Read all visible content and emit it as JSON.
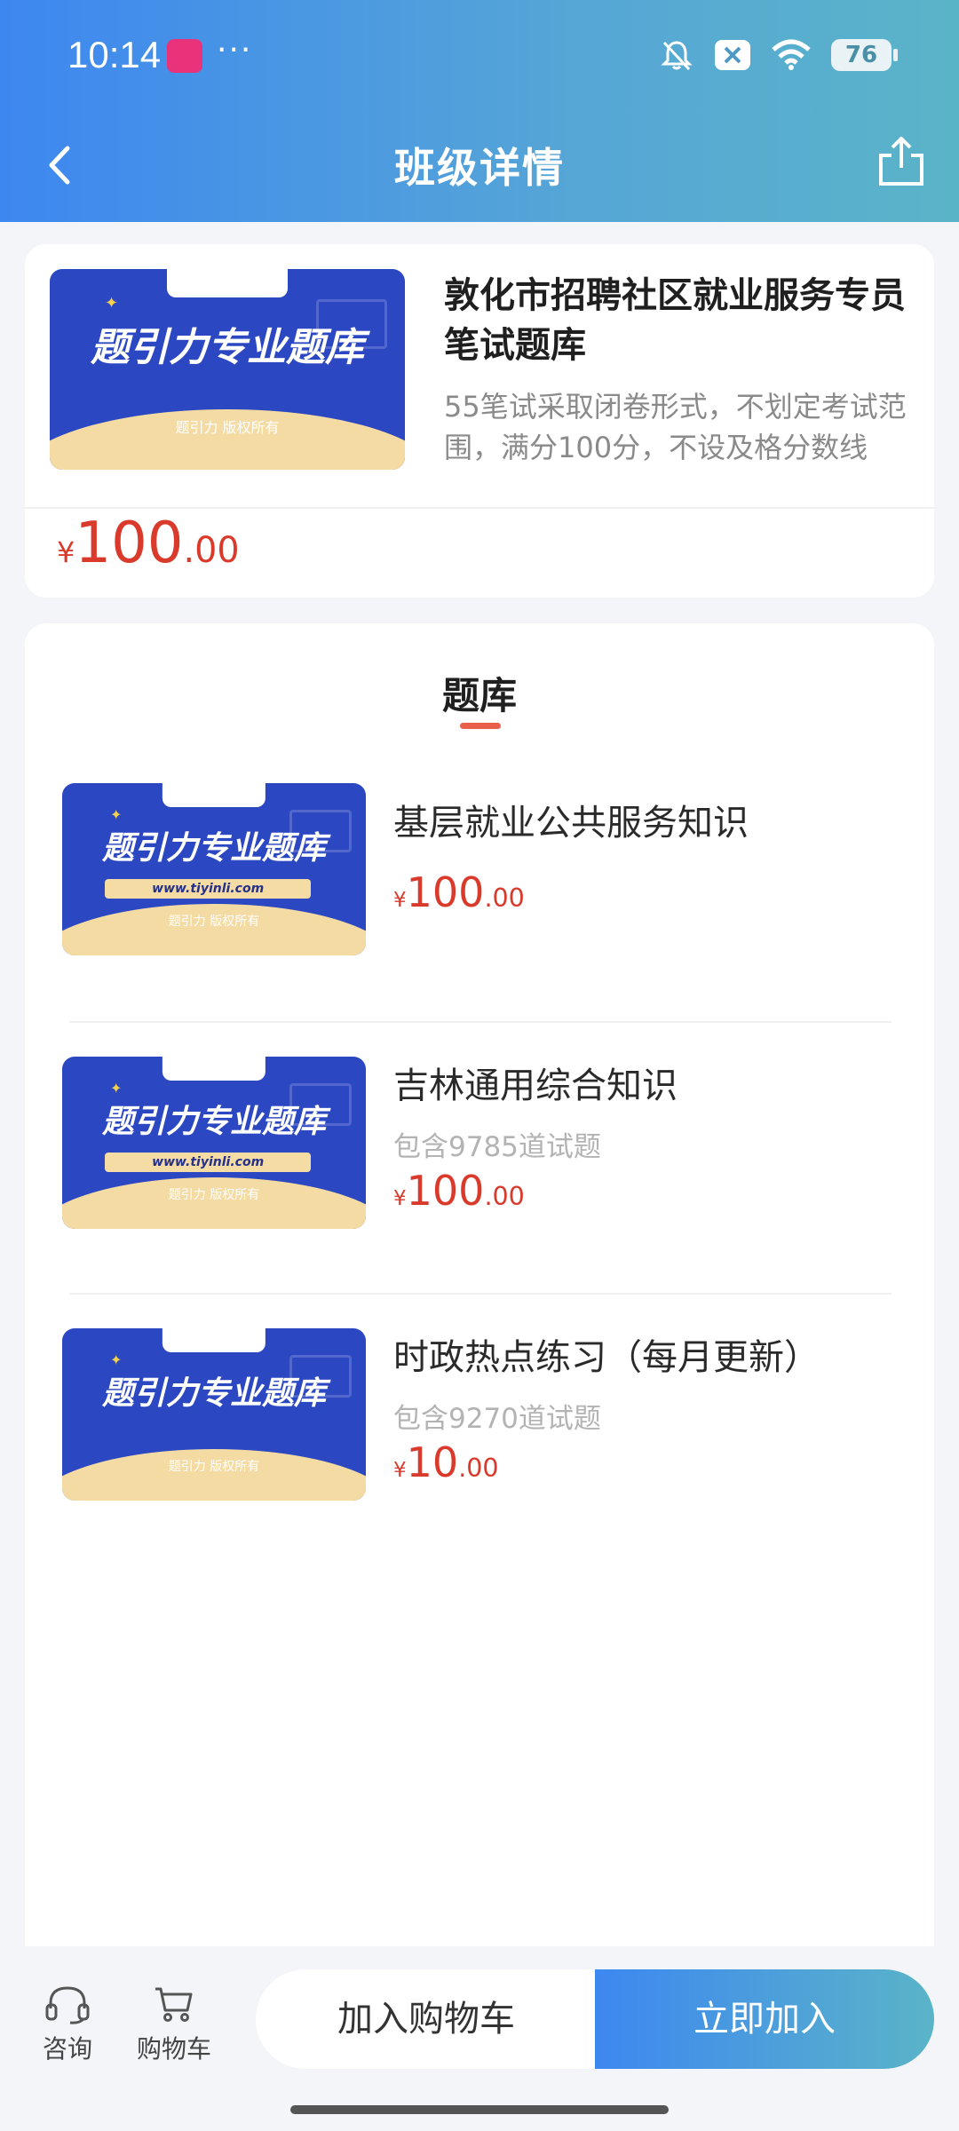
{
  "status_bar": {
    "time": "10:14",
    "dots": "···",
    "battery": "76"
  },
  "nav": {
    "title": "班级详情"
  },
  "class_card": {
    "banner": {
      "title": "题引力专业题库",
      "copyright": "题引力 版权所有"
    },
    "title": "敦化市招聘社区就业服务专员笔试题库",
    "description": "55笔试采取闭卷形式，不划定考试范围，满分100分，不设及格分数线",
    "price": {
      "currency": "¥",
      "integer": "100",
      "decimal": ".00"
    }
  },
  "question_bank": {
    "section_title": "题库",
    "items": [
      {
        "name": "基层就业公共服务知识",
        "count": "",
        "price": {
          "currency": "¥",
          "integer": "100",
          "decimal": ".00"
        },
        "banner": {
          "title": "题引力专业题库",
          "url": "www.tiyinli.com",
          "copyright": "题引力 版权所有"
        }
      },
      {
        "name": "吉林通用综合知识",
        "count": "包含9785道试题",
        "price": {
          "currency": "¥",
          "integer": "100",
          "decimal": ".00"
        },
        "banner": {
          "title": "题引力专业题库",
          "url": "www.tiyinli.com",
          "copyright": "题引力 版权所有"
        }
      },
      {
        "name": "时政热点练习（每月更新）",
        "count": "包含9270道试题",
        "price": {
          "currency": "¥",
          "integer": "10",
          "decimal": ".00"
        },
        "banner": {
          "title": "题引力专业题库",
          "url": "",
          "copyright": "题引力 版权所有"
        }
      }
    ]
  },
  "bottom_bar": {
    "consult_label": "咨询",
    "cart_label": "购物车",
    "add_to_cart_label": "加入购物车",
    "join_now_label": "立即加入"
  },
  "colors": {
    "accent_start": "#3d87f0",
    "accent_end": "#5ab4c8",
    "price": "#d93a2b",
    "banner_blue": "#2c47c2"
  }
}
